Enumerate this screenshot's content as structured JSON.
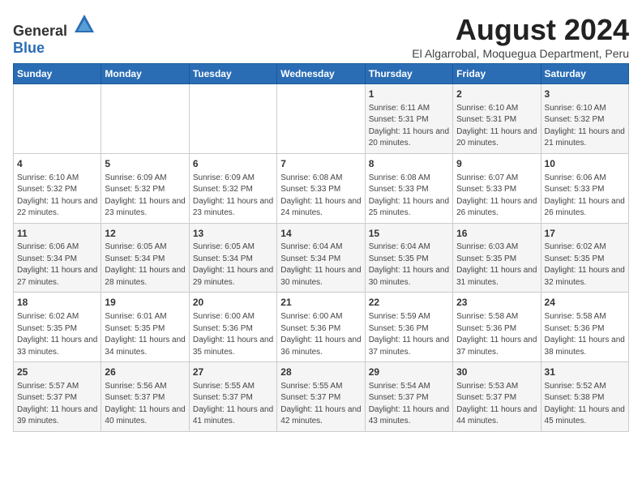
{
  "header": {
    "logo_general": "General",
    "logo_blue": "Blue",
    "month_year": "August 2024",
    "location": "El Algarrobal, Moquegua Department, Peru"
  },
  "weekdays": [
    "Sunday",
    "Monday",
    "Tuesday",
    "Wednesday",
    "Thursday",
    "Friday",
    "Saturday"
  ],
  "weeks": [
    [
      {
        "day": "",
        "content": ""
      },
      {
        "day": "",
        "content": ""
      },
      {
        "day": "",
        "content": ""
      },
      {
        "day": "",
        "content": ""
      },
      {
        "day": "1",
        "content": "Sunrise: 6:11 AM\nSunset: 5:31 PM\nDaylight: 11 hours and 20 minutes."
      },
      {
        "day": "2",
        "content": "Sunrise: 6:10 AM\nSunset: 5:31 PM\nDaylight: 11 hours and 20 minutes."
      },
      {
        "day": "3",
        "content": "Sunrise: 6:10 AM\nSunset: 5:32 PM\nDaylight: 11 hours and 21 minutes."
      }
    ],
    [
      {
        "day": "4",
        "content": "Sunrise: 6:10 AM\nSunset: 5:32 PM\nDaylight: 11 hours and 22 minutes."
      },
      {
        "day": "5",
        "content": "Sunrise: 6:09 AM\nSunset: 5:32 PM\nDaylight: 11 hours and 23 minutes."
      },
      {
        "day": "6",
        "content": "Sunrise: 6:09 AM\nSunset: 5:32 PM\nDaylight: 11 hours and 23 minutes."
      },
      {
        "day": "7",
        "content": "Sunrise: 6:08 AM\nSunset: 5:33 PM\nDaylight: 11 hours and 24 minutes."
      },
      {
        "day": "8",
        "content": "Sunrise: 6:08 AM\nSunset: 5:33 PM\nDaylight: 11 hours and 25 minutes."
      },
      {
        "day": "9",
        "content": "Sunrise: 6:07 AM\nSunset: 5:33 PM\nDaylight: 11 hours and 26 minutes."
      },
      {
        "day": "10",
        "content": "Sunrise: 6:06 AM\nSunset: 5:33 PM\nDaylight: 11 hours and 26 minutes."
      }
    ],
    [
      {
        "day": "11",
        "content": "Sunrise: 6:06 AM\nSunset: 5:34 PM\nDaylight: 11 hours and 27 minutes."
      },
      {
        "day": "12",
        "content": "Sunrise: 6:05 AM\nSunset: 5:34 PM\nDaylight: 11 hours and 28 minutes."
      },
      {
        "day": "13",
        "content": "Sunrise: 6:05 AM\nSunset: 5:34 PM\nDaylight: 11 hours and 29 minutes."
      },
      {
        "day": "14",
        "content": "Sunrise: 6:04 AM\nSunset: 5:34 PM\nDaylight: 11 hours and 30 minutes."
      },
      {
        "day": "15",
        "content": "Sunrise: 6:04 AM\nSunset: 5:35 PM\nDaylight: 11 hours and 30 minutes."
      },
      {
        "day": "16",
        "content": "Sunrise: 6:03 AM\nSunset: 5:35 PM\nDaylight: 11 hours and 31 minutes."
      },
      {
        "day": "17",
        "content": "Sunrise: 6:02 AM\nSunset: 5:35 PM\nDaylight: 11 hours and 32 minutes."
      }
    ],
    [
      {
        "day": "18",
        "content": "Sunrise: 6:02 AM\nSunset: 5:35 PM\nDaylight: 11 hours and 33 minutes."
      },
      {
        "day": "19",
        "content": "Sunrise: 6:01 AM\nSunset: 5:35 PM\nDaylight: 11 hours and 34 minutes."
      },
      {
        "day": "20",
        "content": "Sunrise: 6:00 AM\nSunset: 5:36 PM\nDaylight: 11 hours and 35 minutes."
      },
      {
        "day": "21",
        "content": "Sunrise: 6:00 AM\nSunset: 5:36 PM\nDaylight: 11 hours and 36 minutes."
      },
      {
        "day": "22",
        "content": "Sunrise: 5:59 AM\nSunset: 5:36 PM\nDaylight: 11 hours and 37 minutes."
      },
      {
        "day": "23",
        "content": "Sunrise: 5:58 AM\nSunset: 5:36 PM\nDaylight: 11 hours and 37 minutes."
      },
      {
        "day": "24",
        "content": "Sunrise: 5:58 AM\nSunset: 5:36 PM\nDaylight: 11 hours and 38 minutes."
      }
    ],
    [
      {
        "day": "25",
        "content": "Sunrise: 5:57 AM\nSunset: 5:37 PM\nDaylight: 11 hours and 39 minutes."
      },
      {
        "day": "26",
        "content": "Sunrise: 5:56 AM\nSunset: 5:37 PM\nDaylight: 11 hours and 40 minutes."
      },
      {
        "day": "27",
        "content": "Sunrise: 5:55 AM\nSunset: 5:37 PM\nDaylight: 11 hours and 41 minutes."
      },
      {
        "day": "28",
        "content": "Sunrise: 5:55 AM\nSunset: 5:37 PM\nDaylight: 11 hours and 42 minutes."
      },
      {
        "day": "29",
        "content": "Sunrise: 5:54 AM\nSunset: 5:37 PM\nDaylight: 11 hours and 43 minutes."
      },
      {
        "day": "30",
        "content": "Sunrise: 5:53 AM\nSunset: 5:37 PM\nDaylight: 11 hours and 44 minutes."
      },
      {
        "day": "31",
        "content": "Sunrise: 5:52 AM\nSunset: 5:38 PM\nDaylight: 11 hours and 45 minutes."
      }
    ]
  ]
}
